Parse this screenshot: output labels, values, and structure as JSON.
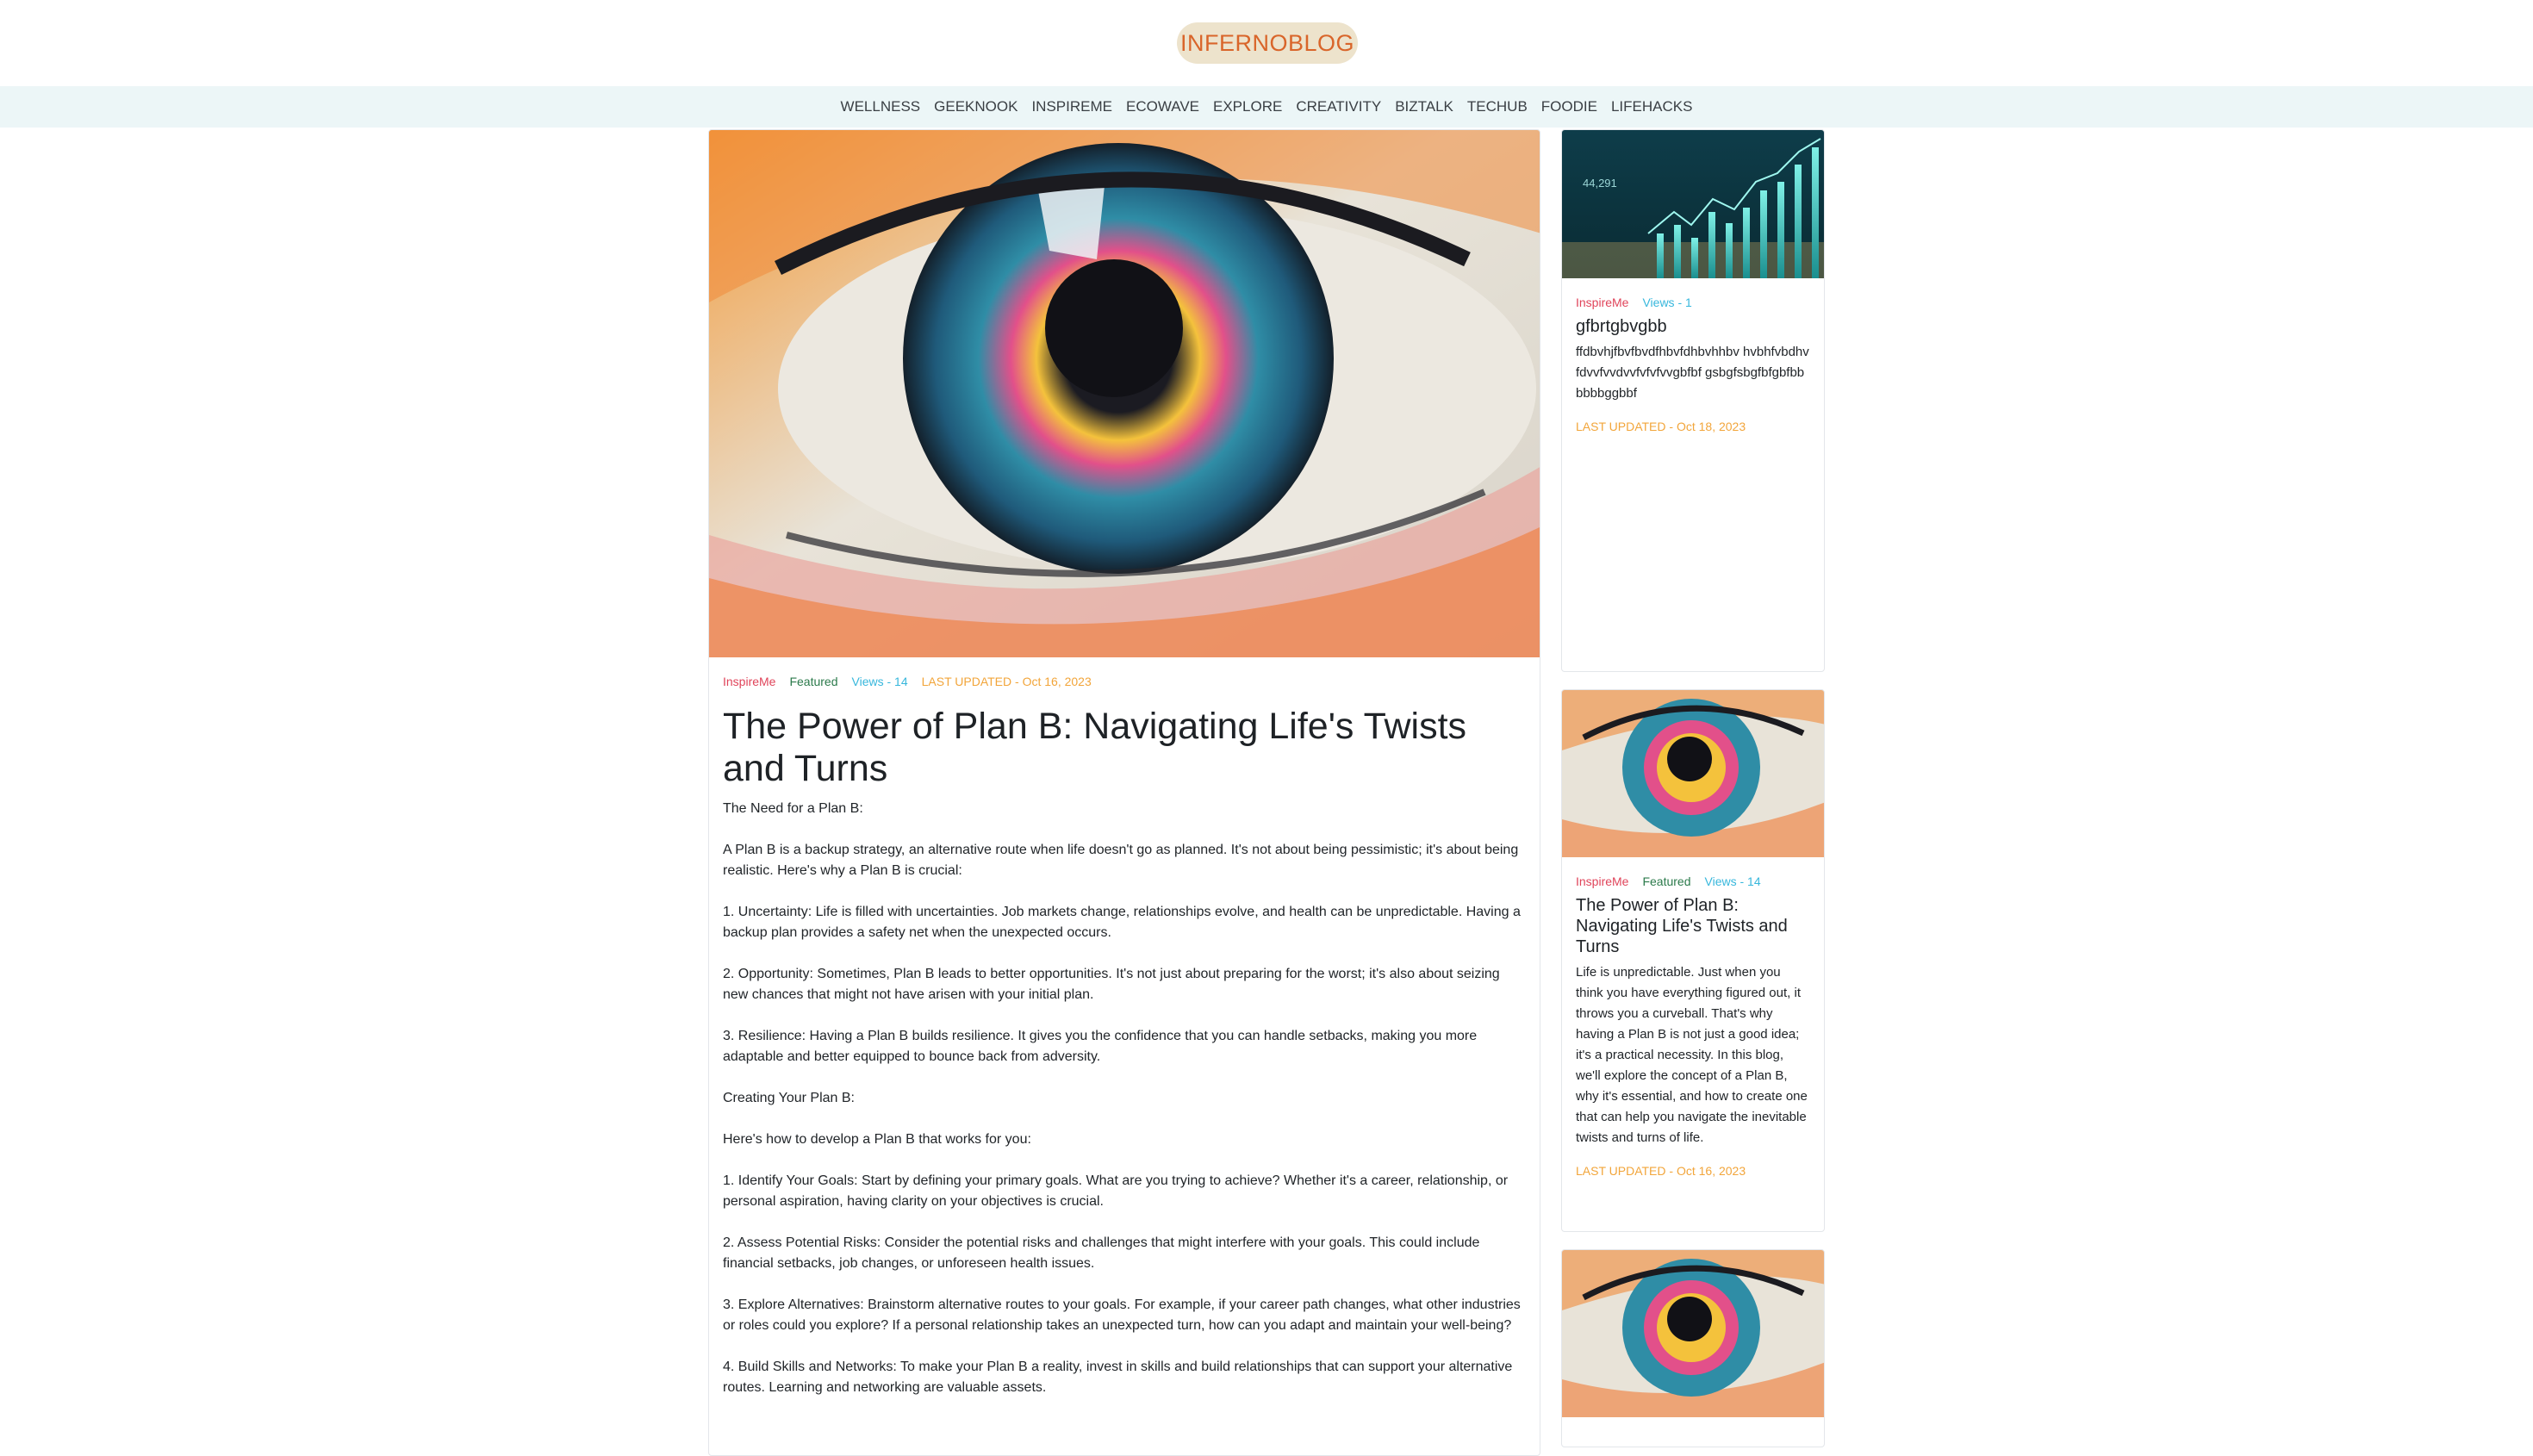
{
  "brand": {
    "logo": "INFERNOBLOG"
  },
  "nav": [
    "WELLNESS",
    "GEEKNOOK",
    "INSPIREME",
    "ECOWAVE",
    "EXPLORE",
    "CREATIVITY",
    "BIZTALK",
    "TECHUB",
    "FOODIE",
    "LIFEHACKS"
  ],
  "article": {
    "category": "InspireMe",
    "featured": "Featured",
    "views": "Views - 14",
    "updated": "LAST UPDATED - Oct 16, 2023",
    "title": "The Power of Plan B: Navigating Life's Twists and Turns",
    "paragraphs": [
      "The Need for a Plan B:",
      "A Plan B is a backup strategy, an alternative route when life doesn't go as planned. It's not about being pessimistic; it's about being realistic. Here's why a Plan B is crucial:",
      "1. Uncertainty: Life is filled with uncertainties. Job markets change, relationships evolve, and health can be unpredictable. Having a backup plan provides a safety net when the unexpected occurs.",
      "2. Opportunity: Sometimes, Plan B leads to better opportunities. It's not just about preparing for the worst; it's also about seizing new chances that might not have arisen with your initial plan.",
      "3. Resilience: Having a Plan B builds resilience. It gives you the confidence that you can handle setbacks, making you more adaptable and better equipped to bounce back from adversity.",
      "Creating Your Plan B:",
      "Here's how to develop a Plan B that works for you:",
      "1. Identify Your Goals: Start by defining your primary goals. What are you trying to achieve? Whether it's a career, relationship, or personal aspiration, having clarity on your objectives is crucial.",
      "2. Assess Potential Risks: Consider the potential risks and challenges that might interfere with your goals. This could include financial setbacks, job changes, or unforeseen health issues.",
      "3. Explore Alternatives: Brainstorm alternative routes to your goals. For example, if your career path changes, what other industries or roles could you explore? If a personal relationship takes an unexpected turn, how can you adapt and maintain your well-being?",
      "4. Build Skills and Networks: To make your Plan B a reality, invest in skills and build relationships that can support your alternative routes. Learning and networking are valuable assets."
    ]
  },
  "sidebar": {
    "cards": [
      {
        "category": "InspireMe",
        "views": "Views - 1",
        "title": "gfbrtgbvgbb",
        "text": "ffdbvhjfbvfbvdfhbvfdhbvhhbv hvbhfvbdhvfdvvfvvdvvfvfvfvvgbfbf gsbgfsbgfbfgbfbbbbbbggbbf",
        "updated": "LAST UPDATED - Oct 18, 2023",
        "image": "stock-chart-image",
        "chart_label": "44,291"
      },
      {
        "category": "InspireMe",
        "featured": "Featured",
        "views": "Views - 14",
        "title": "The Power of Plan B: Navigating Life's Twists and Turns",
        "text": "Life is unpredictable. Just when you think you have everything figured out, it throws you a curveball. That's why having a Plan B is not just a good idea; it's a practical necessity. In this blog, we'll explore the concept of a Plan B, why it's essential, and how to create one that can help you navigate the inevitable twists and turns of life.",
        "updated": "LAST UPDATED - Oct 16, 2023",
        "image": "eye-painting-image"
      },
      {
        "image": "eye-painting-image"
      }
    ]
  },
  "colors": {
    "logo_bg": "#ede3cc",
    "logo_text": "#d9652a",
    "nav_bg": "#ecf6f7",
    "category": "#e0445a",
    "featured": "#2b7a4b",
    "views": "#37b7dc",
    "updated": "#f2a53a"
  }
}
